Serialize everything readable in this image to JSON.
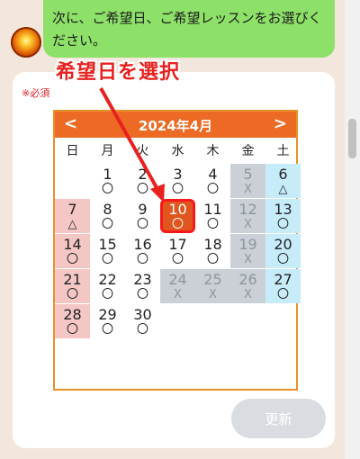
{
  "chat": {
    "message": "次に、ご希望日、ご希望レッスンをお選びください。"
  },
  "annotation": {
    "label": "希望日を選択"
  },
  "form": {
    "required_label": "※必須",
    "update_button": "更新"
  },
  "calendar": {
    "title": "2024年4月",
    "prev_label": "<",
    "next_label": ">",
    "weekdays": [
      "日",
      "月",
      "火",
      "水",
      "木",
      "金",
      "土"
    ],
    "weeks": [
      [
        null,
        {
          "d": "1",
          "m": "〇",
          "s": "avail"
        },
        {
          "d": "2",
          "m": "〇",
          "s": "avail"
        },
        {
          "d": "3",
          "m": "〇",
          "s": "avail"
        },
        {
          "d": "4",
          "m": "〇",
          "s": "avail"
        },
        {
          "d": "5",
          "m": "X",
          "s": "full"
        },
        {
          "d": "6",
          "m": "△",
          "s": "sat"
        }
      ],
      [
        {
          "d": "7",
          "m": "△",
          "s": "sun"
        },
        {
          "d": "8",
          "m": "〇",
          "s": "avail"
        },
        {
          "d": "9",
          "m": "〇",
          "s": "avail"
        },
        {
          "d": "10",
          "m": "〇",
          "s": "sel"
        },
        {
          "d": "11",
          "m": "〇",
          "s": "avail"
        },
        {
          "d": "12",
          "m": "X",
          "s": "full"
        },
        {
          "d": "13",
          "m": "〇",
          "s": "sat"
        }
      ],
      [
        {
          "d": "14",
          "m": "〇",
          "s": "sun"
        },
        {
          "d": "15",
          "m": "〇",
          "s": "avail"
        },
        {
          "d": "16",
          "m": "〇",
          "s": "avail"
        },
        {
          "d": "17",
          "m": "〇",
          "s": "avail"
        },
        {
          "d": "18",
          "m": "〇",
          "s": "avail"
        },
        {
          "d": "19",
          "m": "X",
          "s": "full"
        },
        {
          "d": "20",
          "m": "〇",
          "s": "sat"
        }
      ],
      [
        {
          "d": "21",
          "m": "〇",
          "s": "sun"
        },
        {
          "d": "22",
          "m": "〇",
          "s": "avail"
        },
        {
          "d": "23",
          "m": "〇",
          "s": "avail"
        },
        {
          "d": "24",
          "m": "X",
          "s": "full"
        },
        {
          "d": "25",
          "m": "X",
          "s": "full"
        },
        {
          "d": "26",
          "m": "X",
          "s": "full"
        },
        {
          "d": "27",
          "m": "〇",
          "s": "sat"
        }
      ],
      [
        {
          "d": "28",
          "m": "〇",
          "s": "sun"
        },
        {
          "d": "29",
          "m": "〇",
          "s": "avail"
        },
        {
          "d": "30",
          "m": "〇",
          "s": "avail"
        },
        null,
        null,
        null,
        null
      ]
    ]
  },
  "colors": {
    "header": "#ec6a24",
    "selected": "#e0561e",
    "annotation": "#e8211f"
  }
}
